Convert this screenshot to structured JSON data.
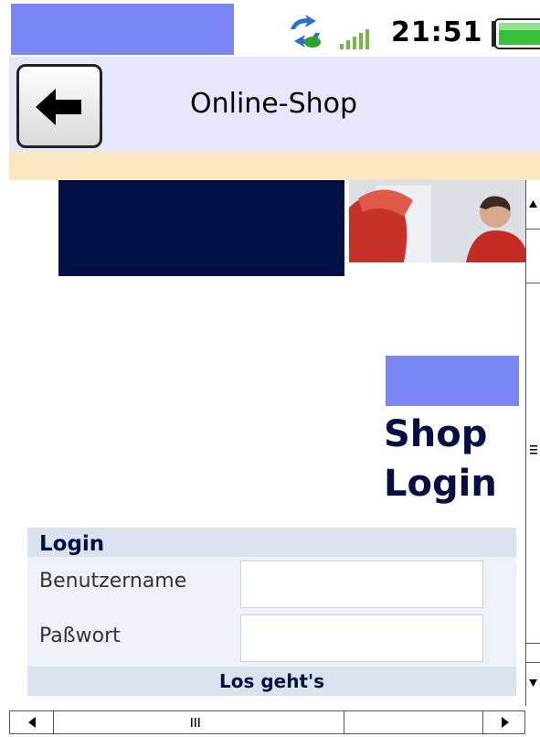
{
  "status_bar": {
    "time": "21:51",
    "icons": [
      "sync-icon",
      "signal-icon",
      "battery-icon"
    ]
  },
  "title_bar": {
    "title": "Online-Shop",
    "back_icon": "arrow-left-icon"
  },
  "main": {
    "heading_line1": "Shop",
    "heading_line2": "Login"
  },
  "login_form": {
    "header": "Login",
    "username_label": "Benutzername",
    "username_value": "",
    "password_label": "Paßwort",
    "password_value": "",
    "submit_label": "Los geht's"
  },
  "colors": {
    "accent": "#7b86f5",
    "navy": "#001044",
    "titlebar_bg": "#e7e7fc",
    "titlebar_strip": "#fde7c3",
    "form_bg": "#eef1f8",
    "form_header": "#dbe3ee"
  }
}
